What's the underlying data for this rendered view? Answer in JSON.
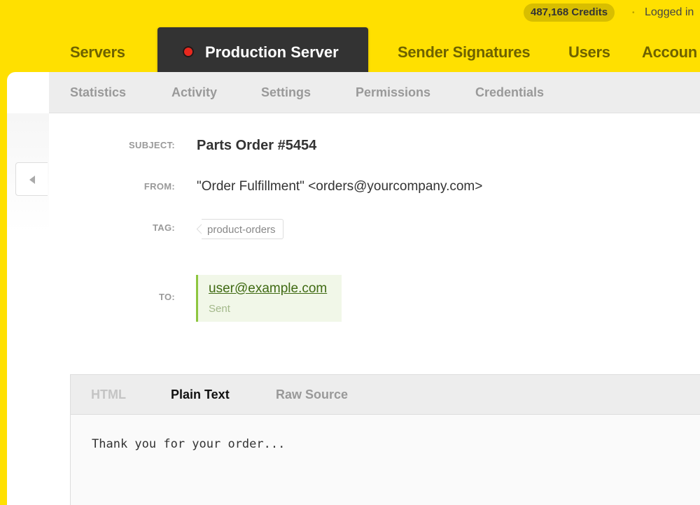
{
  "topbar": {
    "credits": "487,168 Credits",
    "separator": "•",
    "logged_in": "Logged in"
  },
  "nav": {
    "items": [
      {
        "label": "Servers"
      },
      {
        "label": "Production Server",
        "active": true,
        "status_color": "#E8281E"
      },
      {
        "label": "Sender Signatures"
      },
      {
        "label": "Users"
      },
      {
        "label": "Accoun"
      }
    ]
  },
  "subnav": {
    "items": [
      "Statistics",
      "Activity",
      "Settings",
      "Permissions",
      "Credentials"
    ]
  },
  "message": {
    "subject_label": "SUBJECT:",
    "subject": "Parts Order #5454",
    "from_label": "FROM:",
    "from": "\"Order Fulfillment\" <orders@yourcompany.com>",
    "tag_label": "TAG:",
    "tag": "product-orders",
    "to_label": "TO:",
    "to_email": "user@example.com",
    "to_status": "Sent"
  },
  "viewer": {
    "tabs": [
      {
        "label": "HTML",
        "state": "disabled"
      },
      {
        "label": "Plain Text",
        "state": "active"
      },
      {
        "label": "Raw Source",
        "state": "inactive"
      }
    ],
    "body": "Thank you for your order..."
  },
  "colors": {
    "brand_yellow": "#FFE000",
    "active_tab_bg": "#333333",
    "sent_accent": "#8DC63F"
  }
}
